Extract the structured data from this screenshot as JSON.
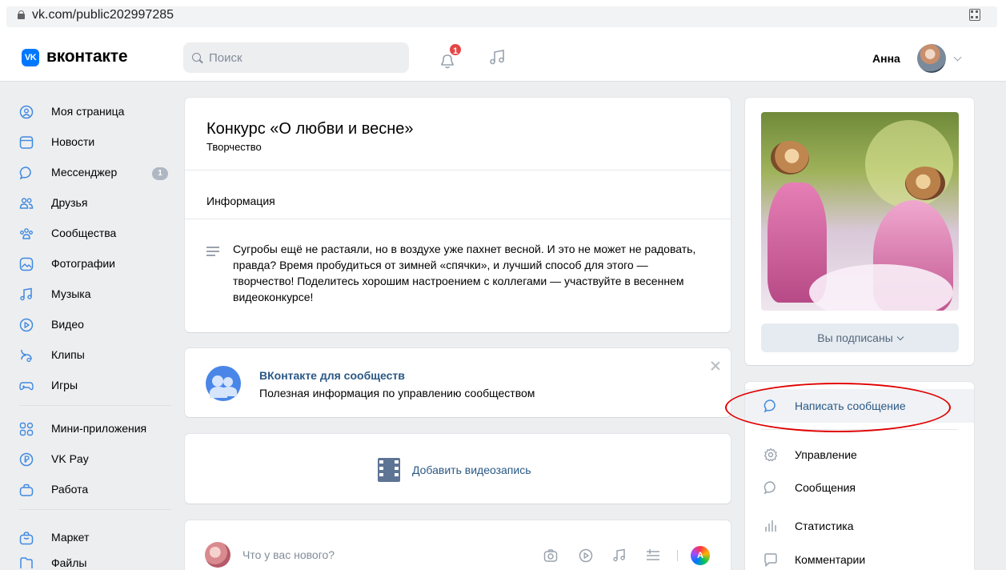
{
  "browser": {
    "url": "vk.com/public202997285"
  },
  "header": {
    "logo_mark": "VK",
    "logo_text": "вконтакте",
    "search_placeholder": "Поиск",
    "notifications_count": "1",
    "user_name": "Анна"
  },
  "sidebar": {
    "items": [
      {
        "label": "Моя страница",
        "icon": "profile-icon"
      },
      {
        "label": "Новости",
        "icon": "news-icon"
      },
      {
        "label": "Мессенджер",
        "icon": "messenger-icon",
        "badge": "1"
      },
      {
        "label": "Друзья",
        "icon": "friends-icon"
      },
      {
        "label": "Сообщества",
        "icon": "communities-icon"
      },
      {
        "label": "Фотографии",
        "icon": "photos-icon"
      },
      {
        "label": "Музыка",
        "icon": "music-icon"
      },
      {
        "label": "Видео",
        "icon": "video-icon"
      },
      {
        "label": "Клипы",
        "icon": "clips-icon"
      },
      {
        "label": "Игры",
        "icon": "games-icon"
      },
      {
        "label": "Мини-приложения",
        "icon": "mini-apps-icon"
      },
      {
        "label": "VK Pay",
        "icon": "vkpay-icon"
      },
      {
        "label": "Работа",
        "icon": "work-icon"
      },
      {
        "label": "Маркет",
        "icon": "market-icon"
      },
      {
        "label": "Файлы",
        "icon": "files-icon"
      }
    ]
  },
  "community": {
    "title": "Конкурс «О любви и весне»",
    "category": "Творчество",
    "info_heading": "Информация",
    "description": "Сугробы ещё не растаяли, но в воздухе уже пахнет весной. И это не может не радовать, правда? Время пробудиться от зимней «спячки», и лучший способ для этого — творчество! Поделитесь хорошим настроением с коллегами — участвуйте в весеннем видеоконкурсе!"
  },
  "promo": {
    "title": "ВКонтакте для сообществ",
    "subtitle": "Полезная информация по управлению сообществом"
  },
  "video": {
    "add_label": "Добавить видеозапись"
  },
  "composer": {
    "placeholder": "Что у вас нового?",
    "tools": [
      "camera-icon",
      "play-icon",
      "music-icon",
      "list-icon"
    ],
    "author_badge": "A"
  },
  "right": {
    "subscribed_label": "Вы подписаны",
    "actions": [
      {
        "label": "Написать сообщение",
        "icon": "message-bubble-icon"
      },
      {
        "label": "Управление",
        "icon": "gear-icon"
      },
      {
        "label": "Сообщения",
        "icon": "chat-icon"
      },
      {
        "label": "Статистика",
        "icon": "stats-icon"
      },
      {
        "label": "Комментарии",
        "icon": "comments-icon"
      }
    ]
  },
  "colors": {
    "accent": "#0077ff",
    "link": "#2a5885",
    "page_bg": "#edeef0",
    "badge_red": "#e64646",
    "highlight_ellipse": "#e00000"
  }
}
